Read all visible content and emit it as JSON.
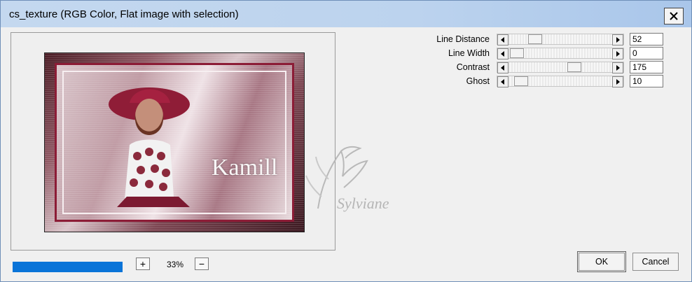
{
  "window": {
    "title": "cs_texture (RGB Color, Flat image with selection)"
  },
  "controls": {
    "close_icon": "close-icon"
  },
  "preview": {
    "watermark_text": "Kamill",
    "signature_text": "Sylviane"
  },
  "sliders": [
    {
      "label": "Line Distance",
      "value": "52",
      "level": 0.3
    },
    {
      "label": "Line Width",
      "value": "0",
      "level": 0.0
    },
    {
      "label": "Contrast",
      "value": "175",
      "level": 0.7
    },
    {
      "label": "Ghost",
      "value": "10",
      "level": 0.05
    }
  ],
  "status": {
    "progress_level": 1.0,
    "zoom_value": "33%"
  },
  "buttons": {
    "ok": "OK",
    "cancel": "Cancel"
  },
  "colors": {
    "progress": "#0a74d8",
    "titlebar": "#bcd3ee",
    "frame_accent": "#8c1c36"
  }
}
